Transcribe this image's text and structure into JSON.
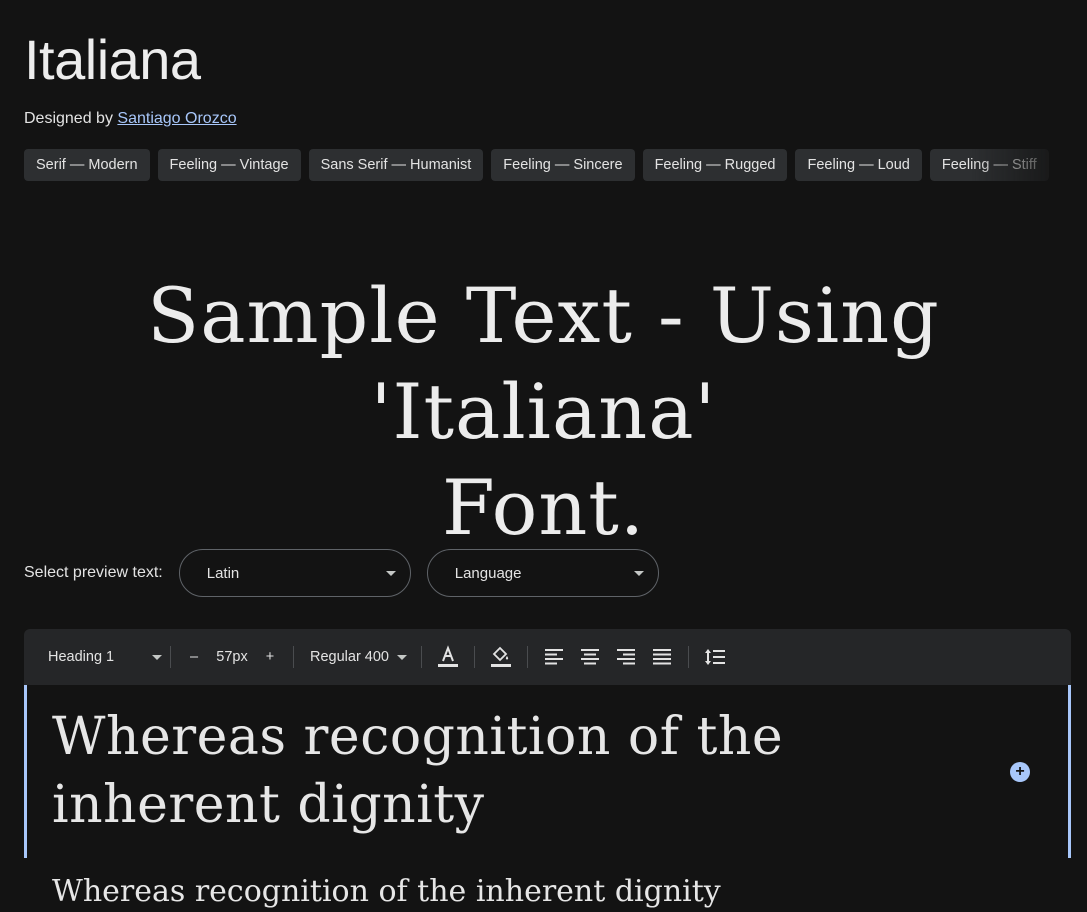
{
  "font": {
    "name": "Italiana",
    "designed_by_prefix": "Designed by",
    "designer": "Santiago Orozco"
  },
  "tags": [
    "Serif — Modern",
    "Feeling — Vintage",
    "Sans Serif — Humanist",
    "Feeling — Sincere",
    "Feeling — Rugged",
    "Feeling — Loud",
    "Feeling — Stiff"
  ],
  "hero": {
    "line1": "Sample Text - Using 'Italiana'",
    "line2": "Font."
  },
  "preview": {
    "label": "Select preview text:",
    "script_value": "Latin",
    "language_value": "Language"
  },
  "toolbar": {
    "style_value": "Heading 1",
    "decrease_label": "–",
    "size_value": "57px",
    "increase_label": "+",
    "weight_value": "Regular 400"
  },
  "editor": {
    "text": "Whereas recognition of the inherent dignity"
  },
  "second_preview": {
    "text": "Whereas recognition of the inherent dignity"
  },
  "colors": {
    "background": "#131313",
    "chip": "#2d2f31",
    "accent": "#a8c7fa",
    "toolbar": "#252628"
  },
  "icons": {
    "text_color": "text-color-icon",
    "fill_color": "fill-color-icon",
    "align_left": "align-left-icon",
    "align_center": "align-center-icon",
    "align_right": "align-right-icon",
    "align_justify": "align-justify-icon",
    "line_height": "line-height-icon",
    "add": "add-circle-icon"
  }
}
